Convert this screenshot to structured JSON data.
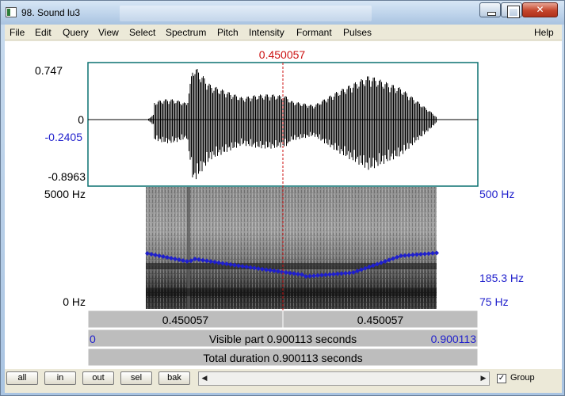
{
  "window": {
    "title": "98. Sound lu3",
    "controls": {
      "minimize": "minimize",
      "maximize": "maximize",
      "close": "close"
    }
  },
  "menu": {
    "items": [
      "File",
      "Edit",
      "Query",
      "View",
      "Select",
      "Spectrum",
      "Pitch",
      "Intensity",
      "Formant",
      "Pulses"
    ],
    "help": "Help"
  },
  "cursor": {
    "time_label": "0.450057",
    "color": "#cc1111"
  },
  "waveform": {
    "y_max": "0.747",
    "y_zero": "0",
    "y_cursor_value": "-0.2405",
    "y_min": "-0.8963"
  },
  "spectrogram": {
    "freq_top": "5000 Hz",
    "freq_bottom": "0 Hz"
  },
  "pitch": {
    "top": "500 Hz",
    "cursor": "185.3 Hz",
    "bottom": "75 Hz",
    "color": "#1f1fcc"
  },
  "timebars": {
    "left_segment": "0.450057",
    "right_segment": "0.450057",
    "visible_start": "0",
    "visible_label": "Visible part 0.900113 seconds",
    "visible_end": "0.900113",
    "total_label": "Total duration 0.900113 seconds"
  },
  "toolbar": {
    "buttons": [
      "all",
      "in",
      "out",
      "sel",
      "bak"
    ],
    "group_label": "Group",
    "group_checked": true
  },
  "icons": {
    "app": "praat-sound-icon",
    "scroll_left": "arrow-left-icon",
    "scroll_right": "arrow-right-icon"
  }
}
